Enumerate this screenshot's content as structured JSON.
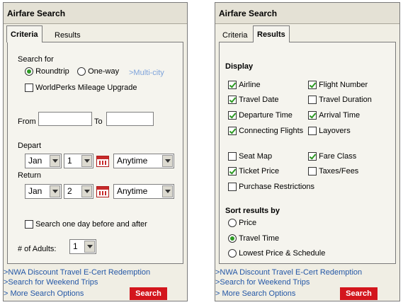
{
  "left": {
    "title": "Airfare Search",
    "tabs": {
      "criteria": "Criteria",
      "results": "Results"
    },
    "search_for": "Search for",
    "trip_types": {
      "roundtrip": "Roundtrip",
      "oneway": "One-way",
      "multicity": ">Multi-city"
    },
    "worldperks": "WorldPerks Mileage Upgrade",
    "from_label": "From",
    "to_label": "To",
    "depart_label": "Depart",
    "depart": {
      "month": "Jan",
      "day": "1",
      "time": "Anytime"
    },
    "return_label": "Return",
    "return": {
      "month": "Jan",
      "day": "2",
      "time": "Anytime"
    },
    "flexible": "Search one day before and after",
    "adults_label": "# of Adults:",
    "adults": "1"
  },
  "right": {
    "title": "Airfare Search",
    "tabs": {
      "criteria": "Criteria",
      "results": "Results"
    },
    "display_label": "Display",
    "options": {
      "airline": "Airline",
      "flight_number": "Flight Number",
      "travel_date": "Travel Date",
      "travel_duration": "Travel Duration",
      "departure_time": "Departure Time",
      "arrival_time": "Arrival Time",
      "connecting_flights": "Connecting Flights",
      "layovers": "Layovers",
      "seat_map": "Seat Map",
      "fare_class": "Fare Class",
      "ticket_price": "Ticket Price",
      "taxes_fees": "Taxes/Fees",
      "purchase_restrictions": "Purchase Restrictions"
    },
    "sort_label": "Sort results by",
    "sort": {
      "price": "Price",
      "travel_time": "Travel Time",
      "lowest_price_schedule": "Lowest Price & Schedule"
    }
  },
  "footer": {
    "link1": ">NWA Discount Travel E-Cert Redemption",
    "link2": ">Search for Weekend Trips",
    "link3": "> More Search Options",
    "search_button": "Search"
  },
  "colors": {
    "accent_green": "#2d9a23",
    "search_red": "#d3161d",
    "link_blue": "#2457a6"
  }
}
